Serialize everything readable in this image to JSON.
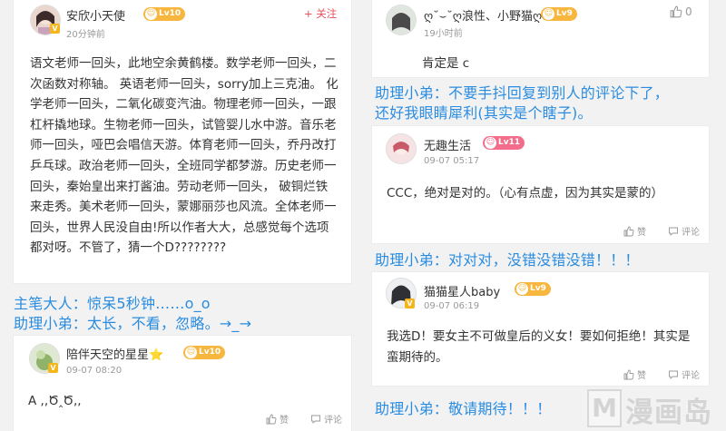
{
  "left": {
    "comment1": {
      "username": "安欣小天使",
      "level": "Lv10",
      "time": "20分钟前",
      "follow": "+ 关注",
      "text": "语文老师一回头，此地空余黄鹤楼。数学老师一回头，二次函数对称轴。  英语老师一回头，sorry加上三克油。  化学老师一回头，二氧化碳变汽油。物理老师一回头，一跟杠杆撬地球。生物老师一回头，试管婴儿水中游。音乐老师一回头，哑巴会唱信天游。体育老师一回头，乔丹改打乒乓球。政治老师一回头，全班同学都梦游。历史老师一回头，秦始皇出来打酱油。劳动老师一回头，  破铜烂铁来走秀。美术老师一回头，蒙娜丽莎也风流。全体老师一回头，世界人民没自由!所以作者大大，总感觉每个选项都对呀。不管了，猜一个D????????"
    },
    "caption1": "主笔大人：惊呆5秒钟……o_o",
    "caption2": "助理小弟：太长，不看，忽略。→_→",
    "comment2": {
      "username": "陪伴天空的星星⭐",
      "level": "Lv10",
      "time": "09-07 08:20",
      "text": "A ,,Ծ‸Ծ,,",
      "like_label": "赞",
      "comment_label": "评论"
    }
  },
  "right": {
    "comment1": {
      "username": "ღ˘⌣˘ღ浪性、小野猫ღ",
      "level": "Lv9",
      "time": "19小时前",
      "likes": "0",
      "text": "肯定是 c"
    },
    "caption1": "助理小弟：不要手抖回复到别人的评论下了，还好我眼睛犀利(其实是个瞎子)。",
    "comment2": {
      "username": "无趣生活",
      "level": "Lv11",
      "time": "09-07 05:17",
      "text": "CCC，绝对是对的。（心有点虚，因为其实是蒙的）",
      "like_label": "赞",
      "comment_label": "评论"
    },
    "caption2": "助理小弟：对对对，没错没错没错！！！",
    "comment3": {
      "username": "猫猫星人baby",
      "level": "Lv9",
      "time": "09-07 06:19",
      "text": "我选D！要女主不可做皇后的义女！要如何拒绝！其实是蛮期待的。",
      "like_label": "赞",
      "comment_label": "评论"
    },
    "caption3": "助理小弟：敬请期待！！！"
  },
  "watermark": {
    "letter": "M",
    "text": "漫画岛"
  },
  "colors": {
    "caption_blue": "#2a8ce0",
    "follow_red": "#e8505b",
    "level_orange": "#f7b63e",
    "level_pink": "#f36d8a"
  }
}
